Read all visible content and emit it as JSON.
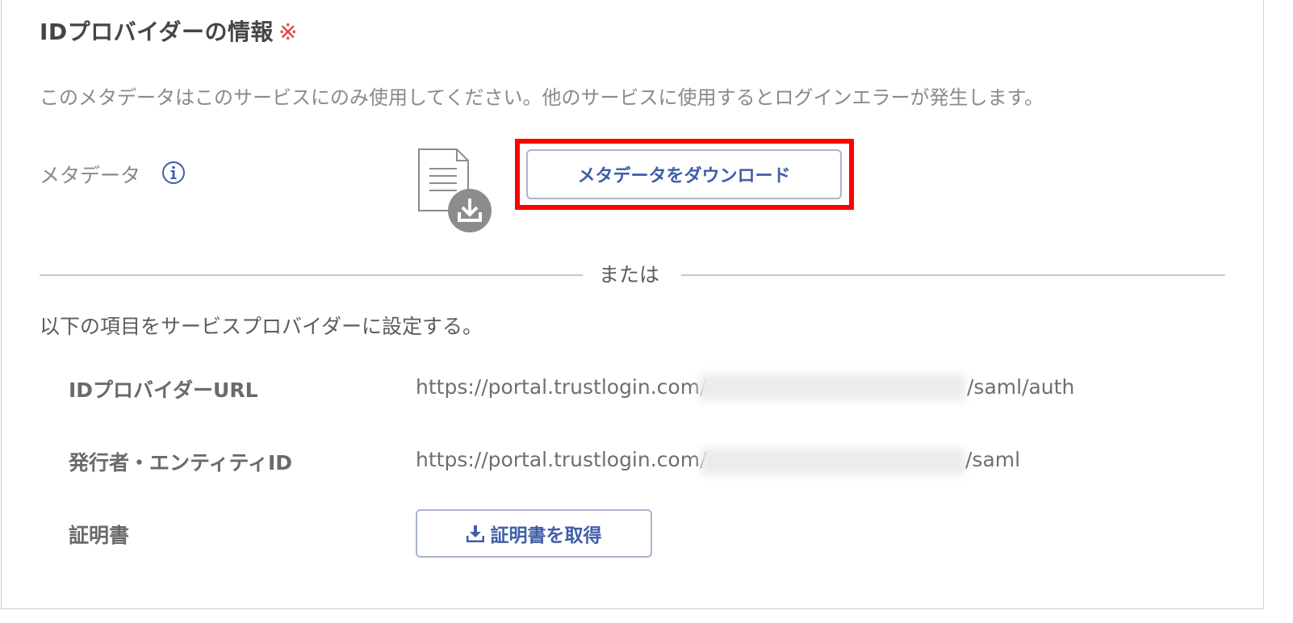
{
  "section": {
    "title": "IDプロバイダーの情報",
    "required_mark": "※",
    "description": "このメタデータはこのサービスにのみ使用してください。他のサービスに使用するとログインエラーが発生します。"
  },
  "metadata": {
    "label": "メタデータ",
    "download_button": "メタデータをダウンロード"
  },
  "divider": {
    "text": "または"
  },
  "manual": {
    "instruction": "以下の項目をサービスプロバイダーに設定する。",
    "idp_url_label": "IDプロバイダーURL",
    "idp_url_prefix": "https://portal.trustlogin.com/",
    "idp_url_suffix": "/saml/auth",
    "entity_id_label": "発行者・エンティティID",
    "entity_id_prefix": "https://portal.trustlogin.com/",
    "entity_id_suffix": "/saml",
    "certificate_label": "証明書",
    "certificate_button": "証明書を取得"
  },
  "colors": {
    "accent": "#3e5ea8",
    "required": "#e0413b",
    "highlight": "#ff0000"
  }
}
